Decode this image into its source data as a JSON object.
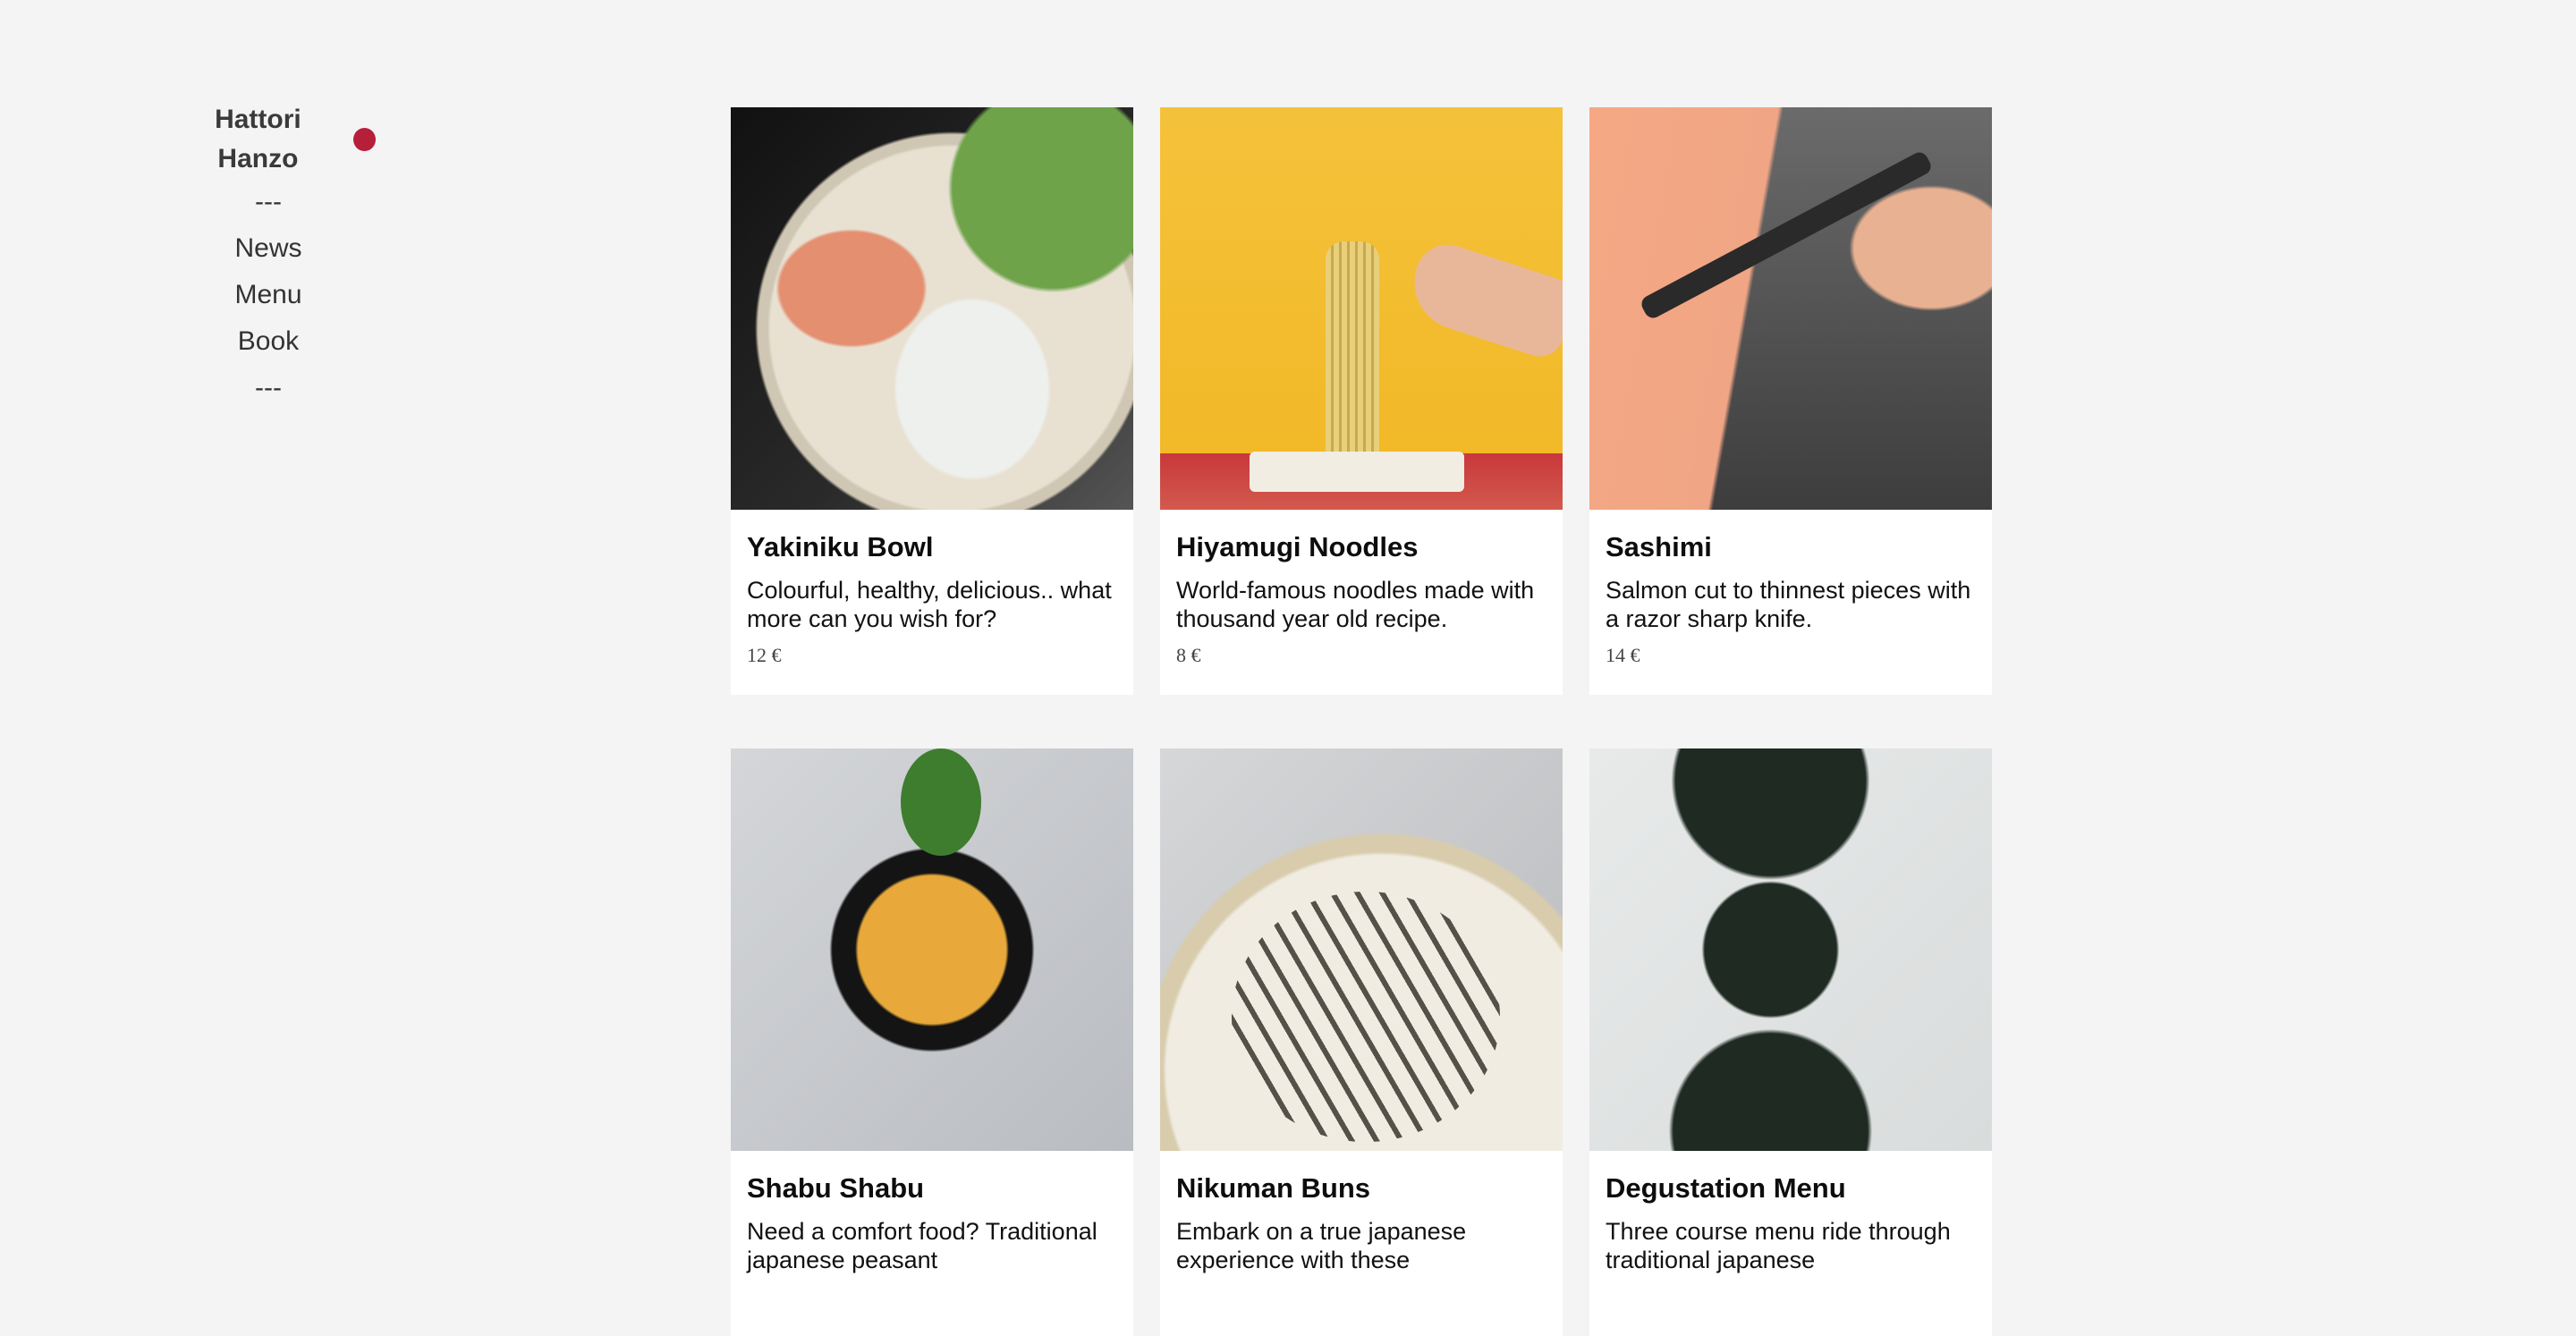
{
  "sidebar": {
    "brand": "Hattori Hanzo",
    "brand_dot_color": "#b51f3a",
    "separator_top": "---",
    "nav": [
      "News",
      "Menu",
      "Book"
    ],
    "separator_bottom": "---"
  },
  "menu": {
    "items": [
      {
        "title": "Yakiniku Bowl",
        "description": "Colourful, healthy, delicious.. what more can you wish for?",
        "price": "12 €"
      },
      {
        "title": "Hiyamugi Noodles",
        "description": "World-famous noodles made with thousand year old recipe.",
        "price": "8 €"
      },
      {
        "title": "Sashimi",
        "description": "Salmon cut to thinnest pieces with a razor sharp knife.",
        "price": "14 €"
      },
      {
        "title": "Shabu Shabu",
        "description": "Need a comfort food? Traditional japanese peasant",
        "price": ""
      },
      {
        "title": "Nikuman Buns",
        "description": "Embark on a true japanese experience with these",
        "price": ""
      },
      {
        "title": "Degustation Menu",
        "description": "Three course menu ride through traditional japanese",
        "price": ""
      }
    ]
  }
}
